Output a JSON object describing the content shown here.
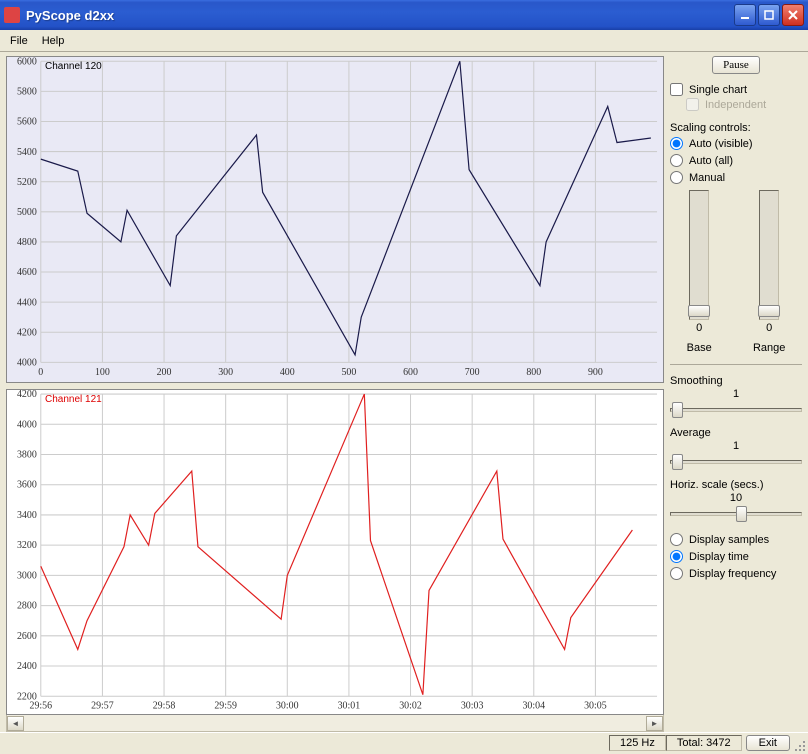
{
  "window": {
    "title": "PyScope d2xx"
  },
  "menu": {
    "file": "File",
    "help": "Help"
  },
  "controls": {
    "pause": "Pause",
    "single_chart": "Single chart",
    "independent": "Independent",
    "scaling_title": "Scaling controls:",
    "scaling_options": [
      "Auto (visible)",
      "Auto (all)",
      "Manual"
    ],
    "scaling_selected": 0,
    "base_label": "Base",
    "range_label": "Range",
    "base_value": "0",
    "range_value": "0",
    "smoothing_label": "Smoothing",
    "smoothing_value": "1",
    "average_label": "Average",
    "average_value": "1",
    "hscale_label": "Horiz. scale (secs.)",
    "hscale_value": "10",
    "display_options": [
      "Display samples",
      "Display time",
      "Display frequency"
    ],
    "display_selected": 1
  },
  "status": {
    "freq": "125 Hz",
    "total": "Total: 3472",
    "exit": "Exit"
  },
  "chart_data": [
    {
      "type": "line",
      "title": "Channel 120",
      "color": "#1a1a4a",
      "bg": "blue",
      "xlabel": "",
      "ylabel": "",
      "ylim": [
        4000,
        6000
      ],
      "xticks": [
        0,
        100,
        200,
        300,
        400,
        500,
        600,
        700,
        800,
        900
      ],
      "yticks": [
        4000,
        4200,
        4400,
        4600,
        4800,
        5000,
        5200,
        5400,
        5600,
        5800,
        6000
      ],
      "x": [
        0,
        60,
        75,
        130,
        140,
        210,
        220,
        350,
        360,
        510,
        520,
        680,
        695,
        810,
        820,
        920,
        935,
        990
      ],
      "values": [
        5350,
        5270,
        4990,
        4800,
        5010,
        4510,
        4840,
        5510,
        5130,
        4050,
        4300,
        6000,
        5280,
        4510,
        4800,
        5700,
        5460,
        5490
      ]
    },
    {
      "type": "line",
      "title": "Channel 121",
      "color": "#e02020",
      "bg": "white",
      "xlabel": "",
      "ylabel": "",
      "ylim": [
        2200,
        4200
      ],
      "xticks_labels": [
        "29:56",
        "29:57",
        "29:58",
        "29:59",
        "30:00",
        "30:01",
        "30:02",
        "30:03",
        "30:04",
        "30:05"
      ],
      "yticks": [
        2200,
        2400,
        2600,
        2800,
        3000,
        3200,
        3400,
        3600,
        3800,
        4000,
        4200
      ],
      "x": [
        0,
        0.6,
        0.75,
        1.35,
        1.45,
        1.75,
        1.85,
        2.45,
        2.55,
        3.9,
        4.0,
        5.25,
        5.35,
        6.2,
        6.3,
        7.4,
        7.5,
        8.5,
        8.6,
        9.6
      ],
      "values": [
        3060,
        2510,
        2700,
        3190,
        3400,
        3200,
        3410,
        3690,
        3190,
        2710,
        3000,
        4200,
        3230,
        2210,
        2900,
        3690,
        3240,
        2510,
        2720,
        3300
      ],
      "xrange": [
        0,
        10
      ]
    }
  ]
}
